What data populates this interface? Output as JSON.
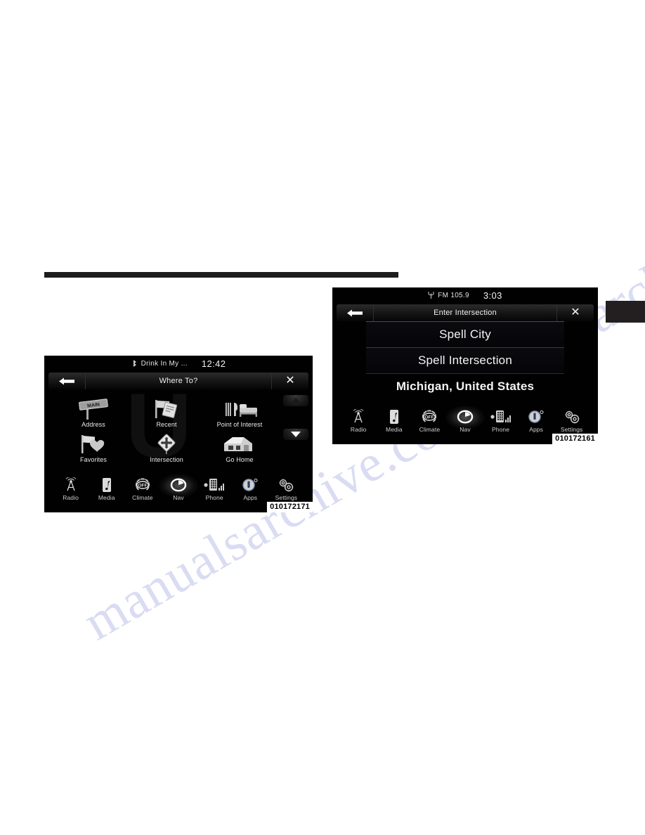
{
  "page": {
    "watermark_line1": "manualsarchive",
    "watermark_line2": "manualsarchive.com"
  },
  "screens": [
    {
      "id": "where-to",
      "figure_number": "010172171",
      "status": {
        "source_icon": "bluetooth-audio-icon",
        "source_label": "Drink In My ...",
        "clock": "12:42"
      },
      "titlebar": {
        "back_icon": "back-arrow-icon",
        "title": "Where To?",
        "close_icon": "close-icon"
      },
      "destinations": [
        {
          "label": "Address",
          "icon": "street-sign-icon"
        },
        {
          "label": "Recent",
          "icon": "flag-document-icon"
        },
        {
          "label": "Point of Interest",
          "icon": "fork-bed-icon"
        },
        {
          "label": "Favorites",
          "icon": "flag-heart-icon"
        },
        {
          "label": "Intersection",
          "icon": "crossroads-diamond-icon"
        },
        {
          "label": "Go Home",
          "icon": "house-icon"
        }
      ],
      "scroll": {
        "up_icon": "scroll-up-arrow-icon",
        "down_icon": "scroll-down-arrow-icon"
      },
      "taskbar": [
        {
          "label": "Radio",
          "icon": "radio-tower-icon"
        },
        {
          "label": "Media",
          "icon": "media-note-icon"
        },
        {
          "label": "Climate",
          "icon": "climate-off-icon",
          "state": "OFF"
        },
        {
          "label": "Nav",
          "icon": "nav-compass-icon",
          "selected": true
        },
        {
          "label": "Phone",
          "icon": "phone-keypad-icon"
        },
        {
          "label": "Apps",
          "icon": "apps-usb-icon"
        },
        {
          "label": "Settings",
          "icon": "settings-gears-icon"
        }
      ]
    },
    {
      "id": "enter-intersection",
      "figure_number": "010172161",
      "status": {
        "source_icon": "radio-antenna-icon",
        "source_label": "FM 105.9",
        "clock": "3:03"
      },
      "titlebar": {
        "back_icon": "back-arrow-icon",
        "title": "Enter Intersection",
        "close_icon": "close-icon"
      },
      "list_rows": [
        {
          "label": "Spell City",
          "style": "button"
        },
        {
          "label": "Spell Intersection",
          "style": "button"
        },
        {
          "label": "Michigan, United States",
          "style": "plain"
        }
      ],
      "taskbar": [
        {
          "label": "Radio",
          "icon": "radio-tower-icon"
        },
        {
          "label": "Media",
          "icon": "media-note-icon"
        },
        {
          "label": "Climate",
          "icon": "climate-off-icon",
          "state": "OFF"
        },
        {
          "label": "Nav",
          "icon": "nav-compass-icon",
          "selected": true
        },
        {
          "label": "Phone",
          "icon": "phone-keypad-icon"
        },
        {
          "label": "Apps",
          "icon": "apps-usb-icon"
        },
        {
          "label": "Settings",
          "icon": "settings-gears-icon"
        }
      ]
    }
  ]
}
